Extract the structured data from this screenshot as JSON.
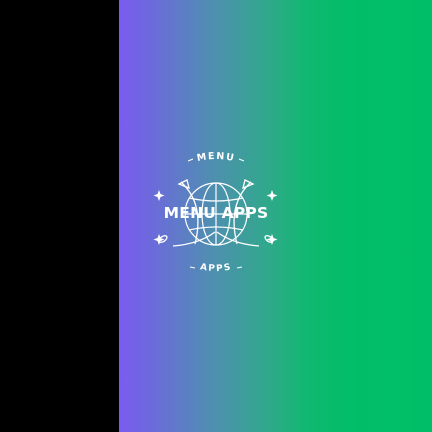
{
  "splash": {
    "logo": {
      "top_arc_text": "MENU",
      "bottom_arc_text": "APPS",
      "wordmark": "MENU APPS",
      "emblem_icon": "globe-with-crossed-planes-icon"
    }
  },
  "colors": {
    "left_bar": "#000000",
    "gradient_start": "#7b5cf2",
    "gradient_end": "#00be67",
    "logo_color": "#ffffff"
  }
}
